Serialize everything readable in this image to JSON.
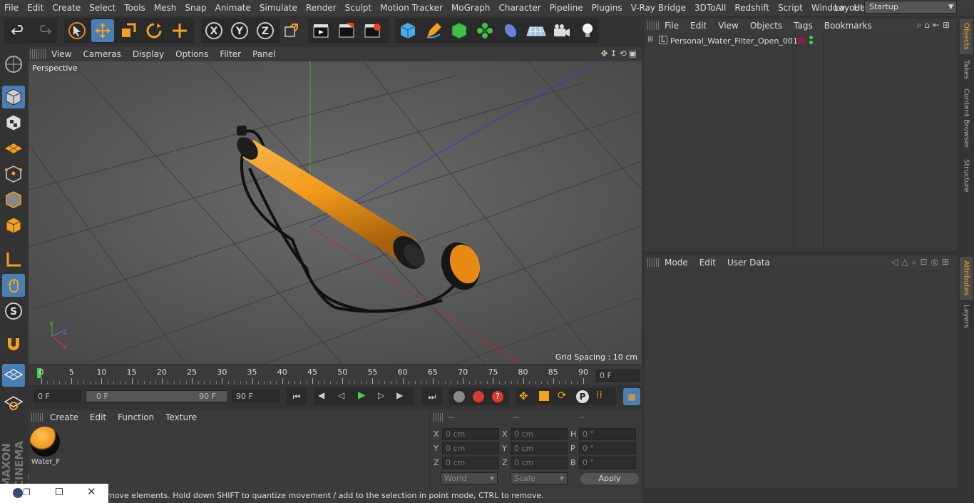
{
  "menubar": {
    "items": [
      "File",
      "Edit",
      "Create",
      "Select",
      "Tools",
      "Mesh",
      "Snap",
      "Animate",
      "Simulate",
      "Render",
      "Sculpt",
      "Motion Tracker",
      "MoGraph",
      "Character",
      "Pipeline",
      "Plugins",
      "V-Ray Bridge",
      "3DToAll",
      "Redshift",
      "Script",
      "Window",
      "Help"
    ],
    "layout_label": "Layout:",
    "layout_value": "Startup"
  },
  "viewport": {
    "menu": [
      "View",
      "Cameras",
      "Display",
      "Options",
      "Filter",
      "Panel"
    ],
    "camera_label": "Perspective",
    "grid_spacing": "Grid Spacing : 10 cm"
  },
  "timeline": {
    "ticks": [
      "0",
      "5",
      "10",
      "15",
      "20",
      "25",
      "30",
      "35",
      "40",
      "45",
      "50",
      "55",
      "60",
      "65",
      "70",
      "75",
      "80",
      "85",
      "90"
    ],
    "current_frame": "0 F"
  },
  "controls": {
    "start_frame": "0 F",
    "range_start": "0 F",
    "range_end": "90 F",
    "end_frame": "90 F"
  },
  "material_manager": {
    "menu": [
      "Create",
      "Edit",
      "Function",
      "Texture"
    ],
    "material_name": "Water_F"
  },
  "coordinates": {
    "headers": [
      "--",
      "--",
      "--"
    ],
    "rows": [
      {
        "l1": "X",
        "v1": "0 cm",
        "l2": "X",
        "v2": "0 cm",
        "l3": "H",
        "v3": "0 °"
      },
      {
        "l1": "Y",
        "v1": "0 cm",
        "l2": "Y",
        "v2": "0 cm",
        "l3": "P",
        "v3": "0 °"
      },
      {
        "l1": "Z",
        "v1": "0 cm",
        "l2": "Z",
        "v2": "0 cm",
        "l3": "B",
        "v3": "0 °"
      }
    ],
    "mode_world": "World",
    "mode_scale": "Scale",
    "apply": "Apply"
  },
  "status": {
    "text": "move elements. Hold down SHIFT to quantize movement / add to the selection in point mode, CTRL to remove."
  },
  "object_manager": {
    "menu": [
      "File",
      "Edit",
      "View",
      "Objects",
      "Tags",
      "Bookmarks"
    ],
    "object_name": "Personal_Water_Filter_Open_001"
  },
  "attributes": {
    "menu": [
      "Mode",
      "Edit",
      "User Data"
    ]
  },
  "right_tabs": [
    "Objects",
    "Takes",
    "Content Browser",
    "Structure",
    "Attributes",
    "Layers"
  ],
  "brand": "MAXON CINEMA 4D",
  "colors": {
    "accent_orange": "#f5a01f",
    "selected_blue": "#4a7fb5",
    "material_orange": "#f09a1e"
  }
}
